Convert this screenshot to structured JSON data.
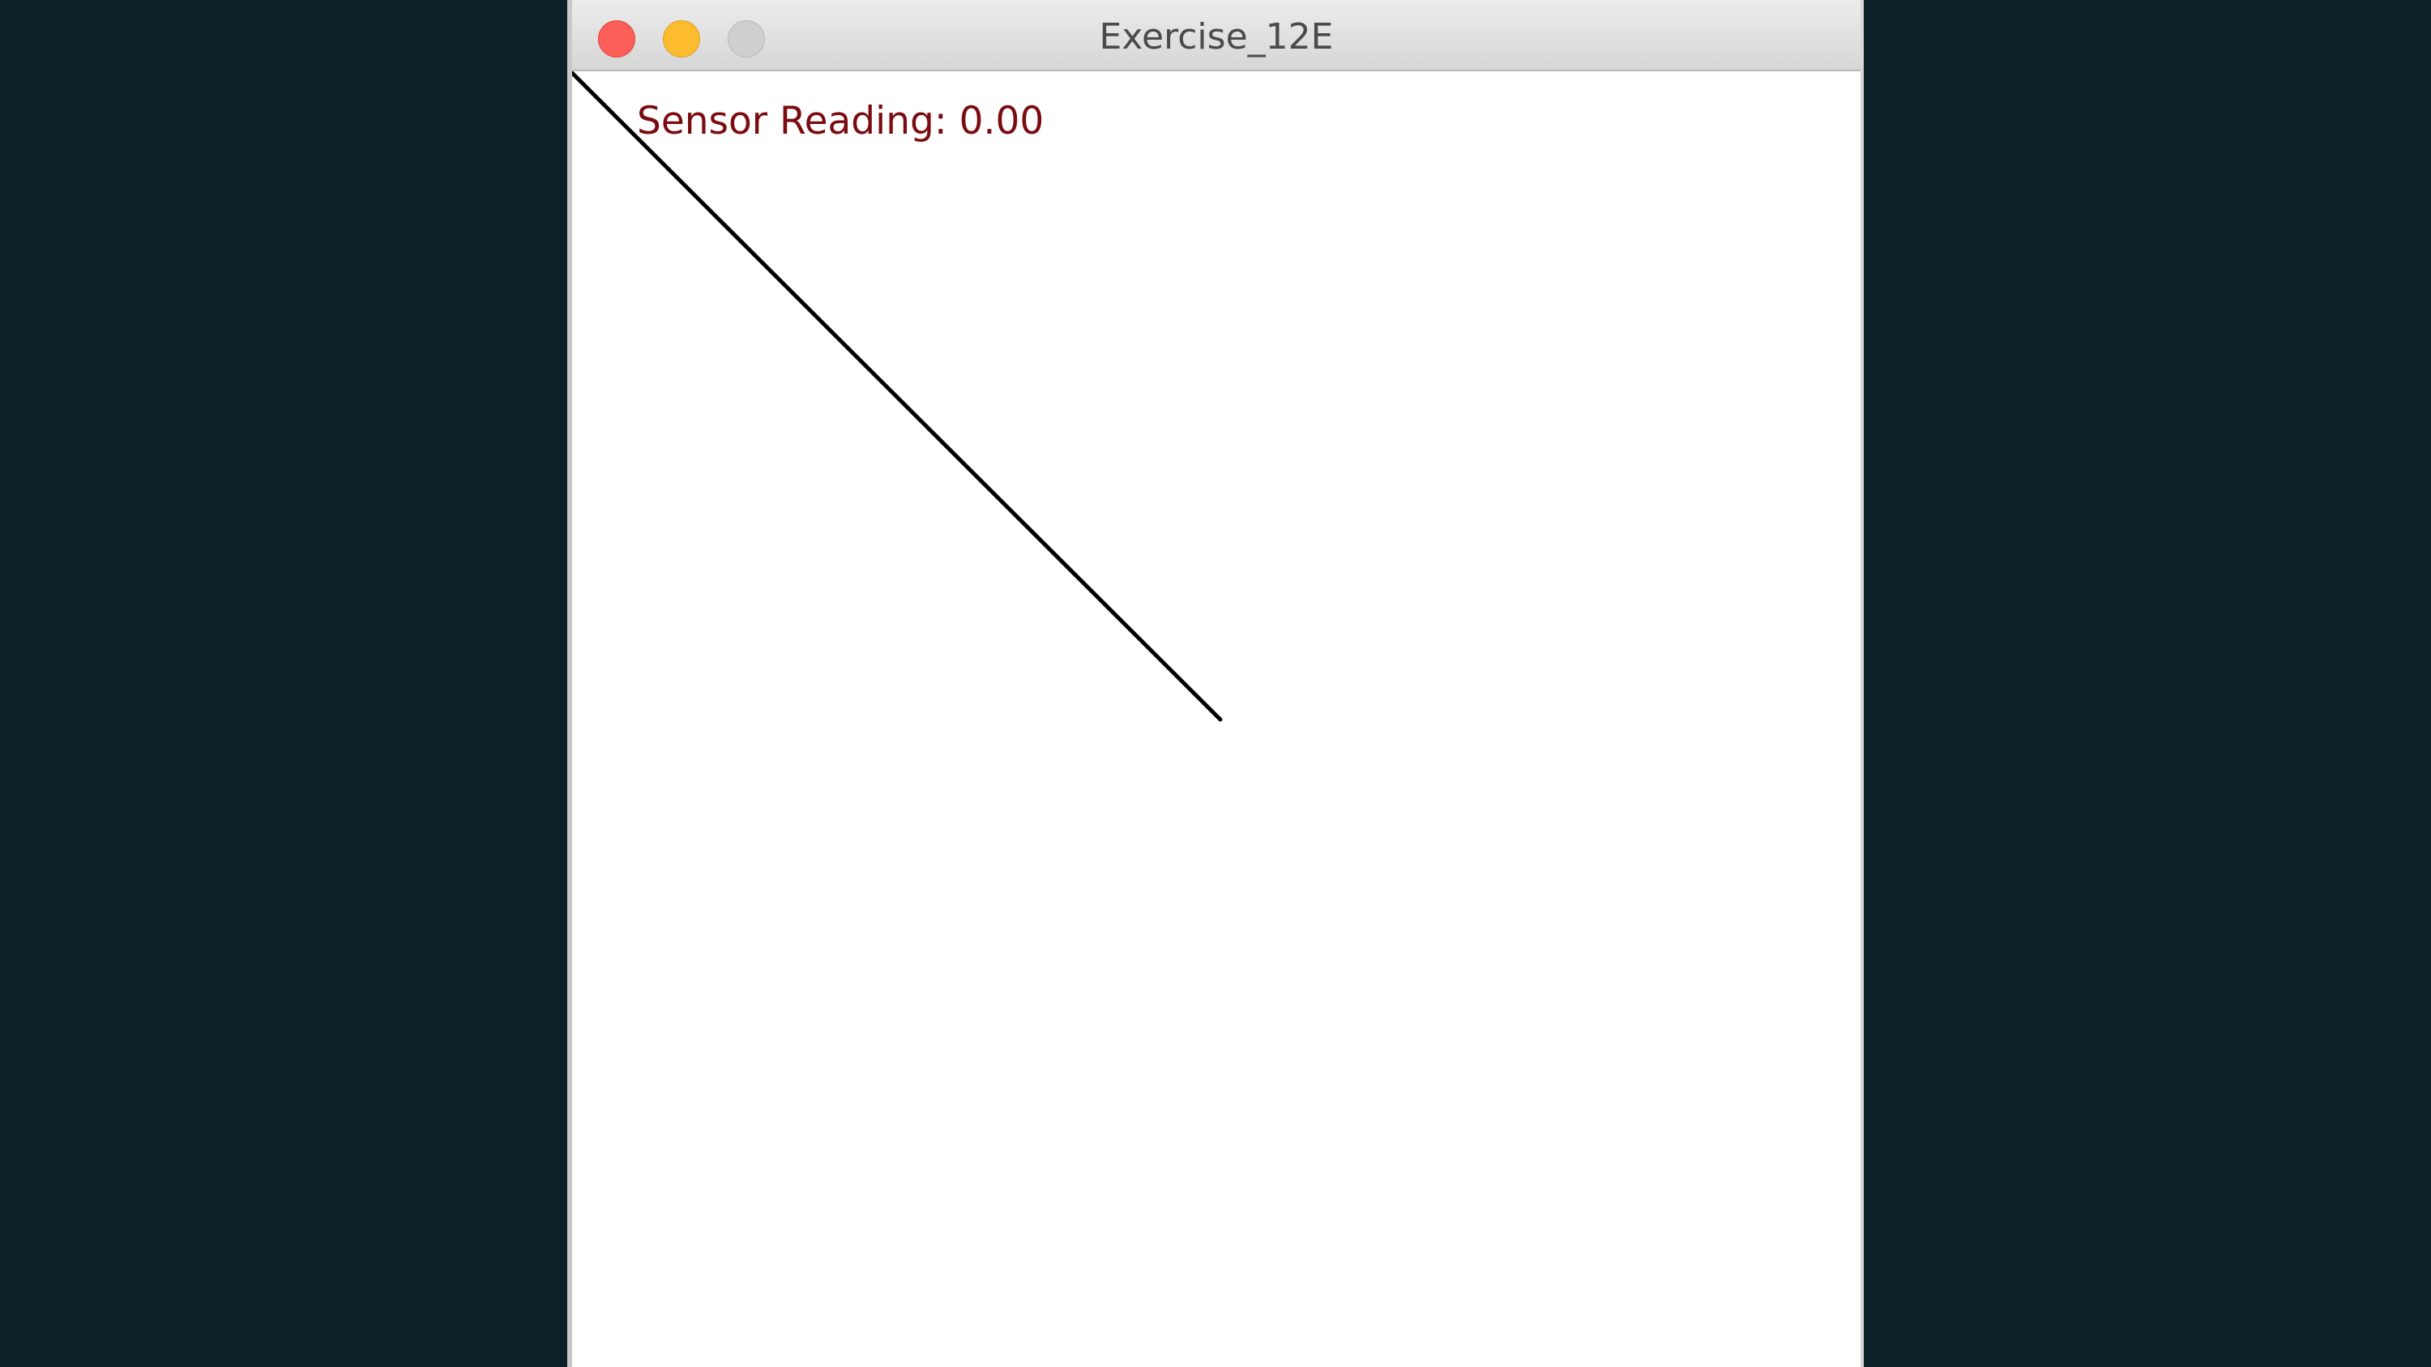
{
  "window": {
    "title": "Exercise_12E",
    "controls": {
      "close_color": "#fc5f57",
      "minimize_color": "#fdbc2e",
      "zoom_color": "#cfcfcf"
    }
  },
  "canvas": {
    "sensor_text": "Sensor Reading: 0.00",
    "text_color": "#7a0b10",
    "line_color": "#000000"
  }
}
